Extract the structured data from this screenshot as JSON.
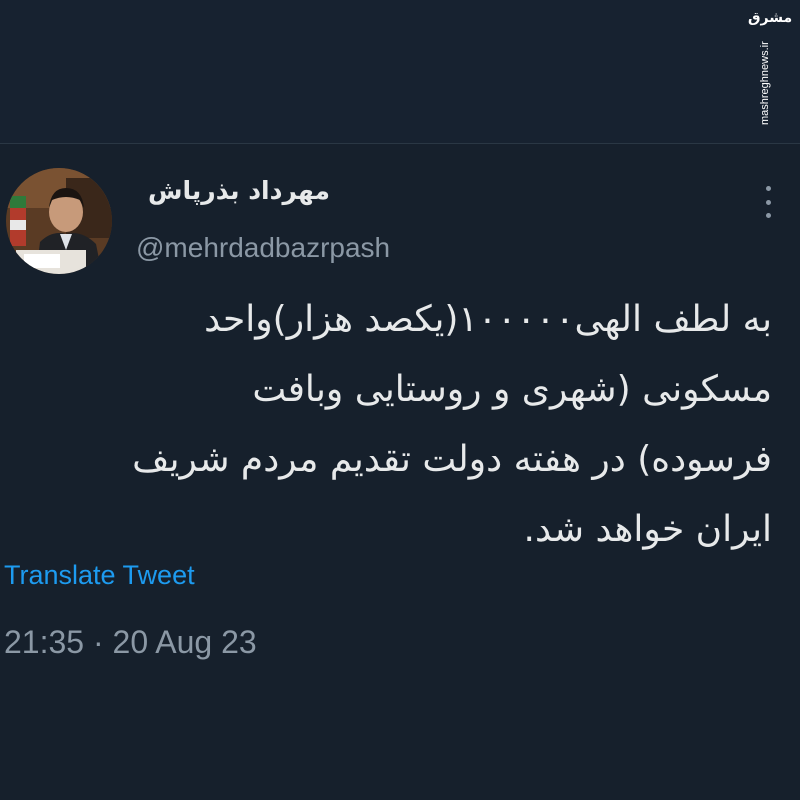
{
  "watermark": {
    "logo_text": "مشرق",
    "site": "mashreghnews.ir"
  },
  "tweet": {
    "display_name": "مهرداد بذرپاش",
    "handle": "@mehrdadbazrpash",
    "text_lines": [
      "به لطف الهی۱۰۰۰۰۰(یکصد هزار)واحد",
      "مسکونی (شهری و روستایی وبافت",
      "فرسوده) در هفته دولت تقدیم مردم شریف",
      "ایران خواهد شد."
    ],
    "translate_label": "Translate Tweet",
    "timestamp": "21:35 · 20 Aug 23"
  },
  "icons": {
    "more": "more-options-icon",
    "avatar": "profile-photo"
  },
  "colors": {
    "background": "#16202c",
    "text": "#e7e9ea",
    "secondary": "#8b98a5",
    "link": "#1d9bf0"
  }
}
